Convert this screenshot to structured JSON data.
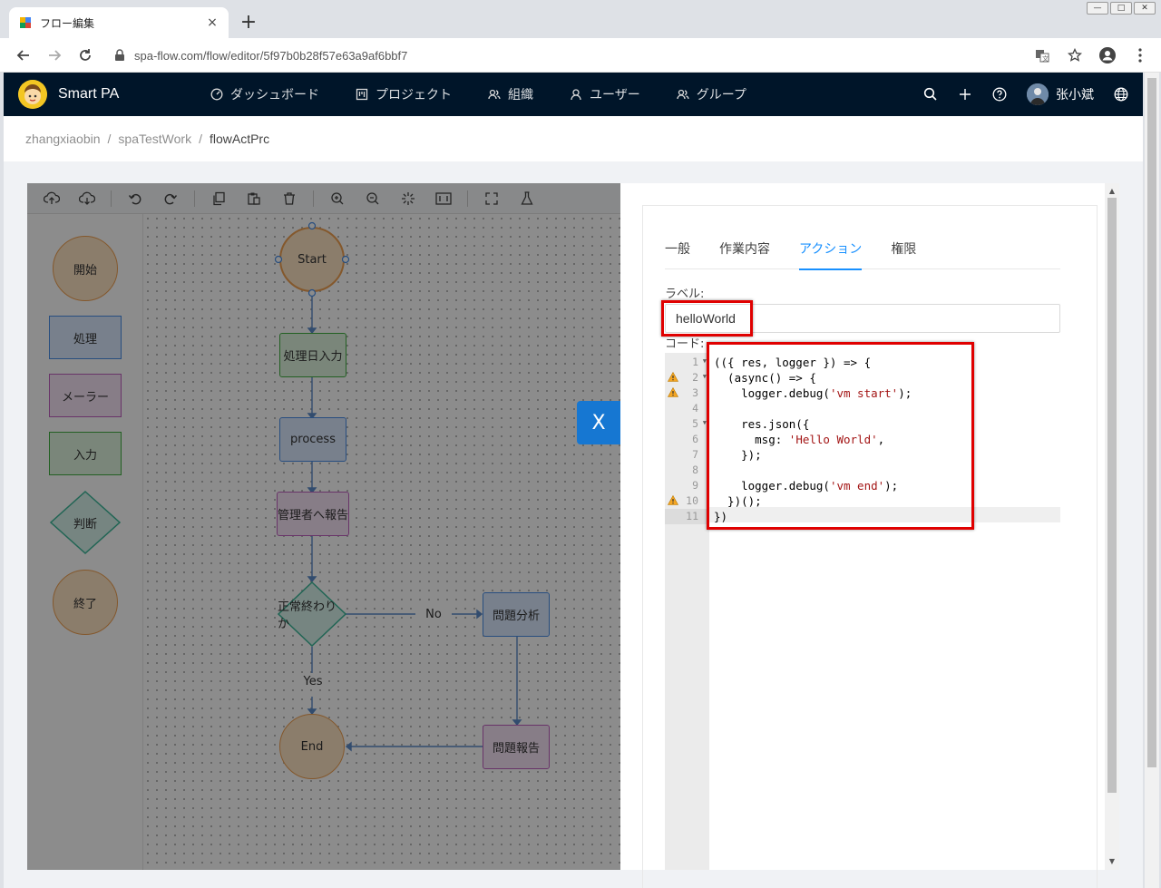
{
  "browser": {
    "tab_title": "フロー編集",
    "tab_close": "×",
    "new_tab": "+",
    "url": "spa-flow.com/flow/editor/5f97b0b28f57e63a9af6bbf7",
    "win_min": "—",
    "win_max": "□",
    "win_close": "✕"
  },
  "app": {
    "name": "Smart PA",
    "nav": [
      {
        "label": "ダッシュボード",
        "icon": "dashboard-icon"
      },
      {
        "label": "プロジェクト",
        "icon": "project-icon"
      },
      {
        "label": "組織",
        "icon": "organization-icon"
      },
      {
        "label": "ユーザー",
        "icon": "user-icon"
      },
      {
        "label": "グループ",
        "icon": "group-icon"
      }
    ],
    "user_name": "张小斌"
  },
  "breadcrumb": [
    "zhangxiaobin",
    "spaTestWork",
    "flowActPrc"
  ],
  "breadcrumb_sep": "/",
  "stencil": [
    "開始",
    "処理",
    "メーラー",
    "入力",
    "判断",
    "終了"
  ],
  "flow": {
    "start": "Start",
    "input": "処理日入力",
    "process": "process",
    "report_admin": "管理者へ報告",
    "decision": "正常終わりか",
    "no": "No",
    "yes": "Yes",
    "analysis": "問題分析",
    "problem_report": "問題報告",
    "end": "End"
  },
  "drawer": {
    "close": "X",
    "tabs": [
      "一般",
      "作業内容",
      "アクション",
      "権限"
    ],
    "active_tab": "アクション",
    "label_caption": "ラベル:",
    "label_value": "helloWorld",
    "code_caption": "コード:",
    "code_lines": [
      "(({ res, logger }) => {",
      "  (async() => {",
      "    logger.debug('vm start');",
      "",
      "    res.json({",
      "      msg: 'Hello World',",
      "    });",
      "",
      "    logger.debug('vm end');",
      "  })();",
      "})"
    ],
    "line_numbers": [
      "1",
      "2",
      "3",
      "4",
      "5",
      "6",
      "7",
      "8",
      "9",
      "10",
      "11"
    ],
    "warning_lines": [
      2,
      3,
      10
    ],
    "fold_lines": [
      1,
      2,
      5
    ]
  },
  "colors": {
    "header_bg": "#001529",
    "accent": "#1890ff",
    "drawer_close": "#1677d2",
    "highlight_box": "#e00000",
    "start_end_fill": "#fde3c4",
    "process_fill": "#dbe9ff",
    "input_fill": "#dff5df",
    "mailer_fill": "#f6e3f6",
    "decision_fill": "#d7f3ec"
  }
}
